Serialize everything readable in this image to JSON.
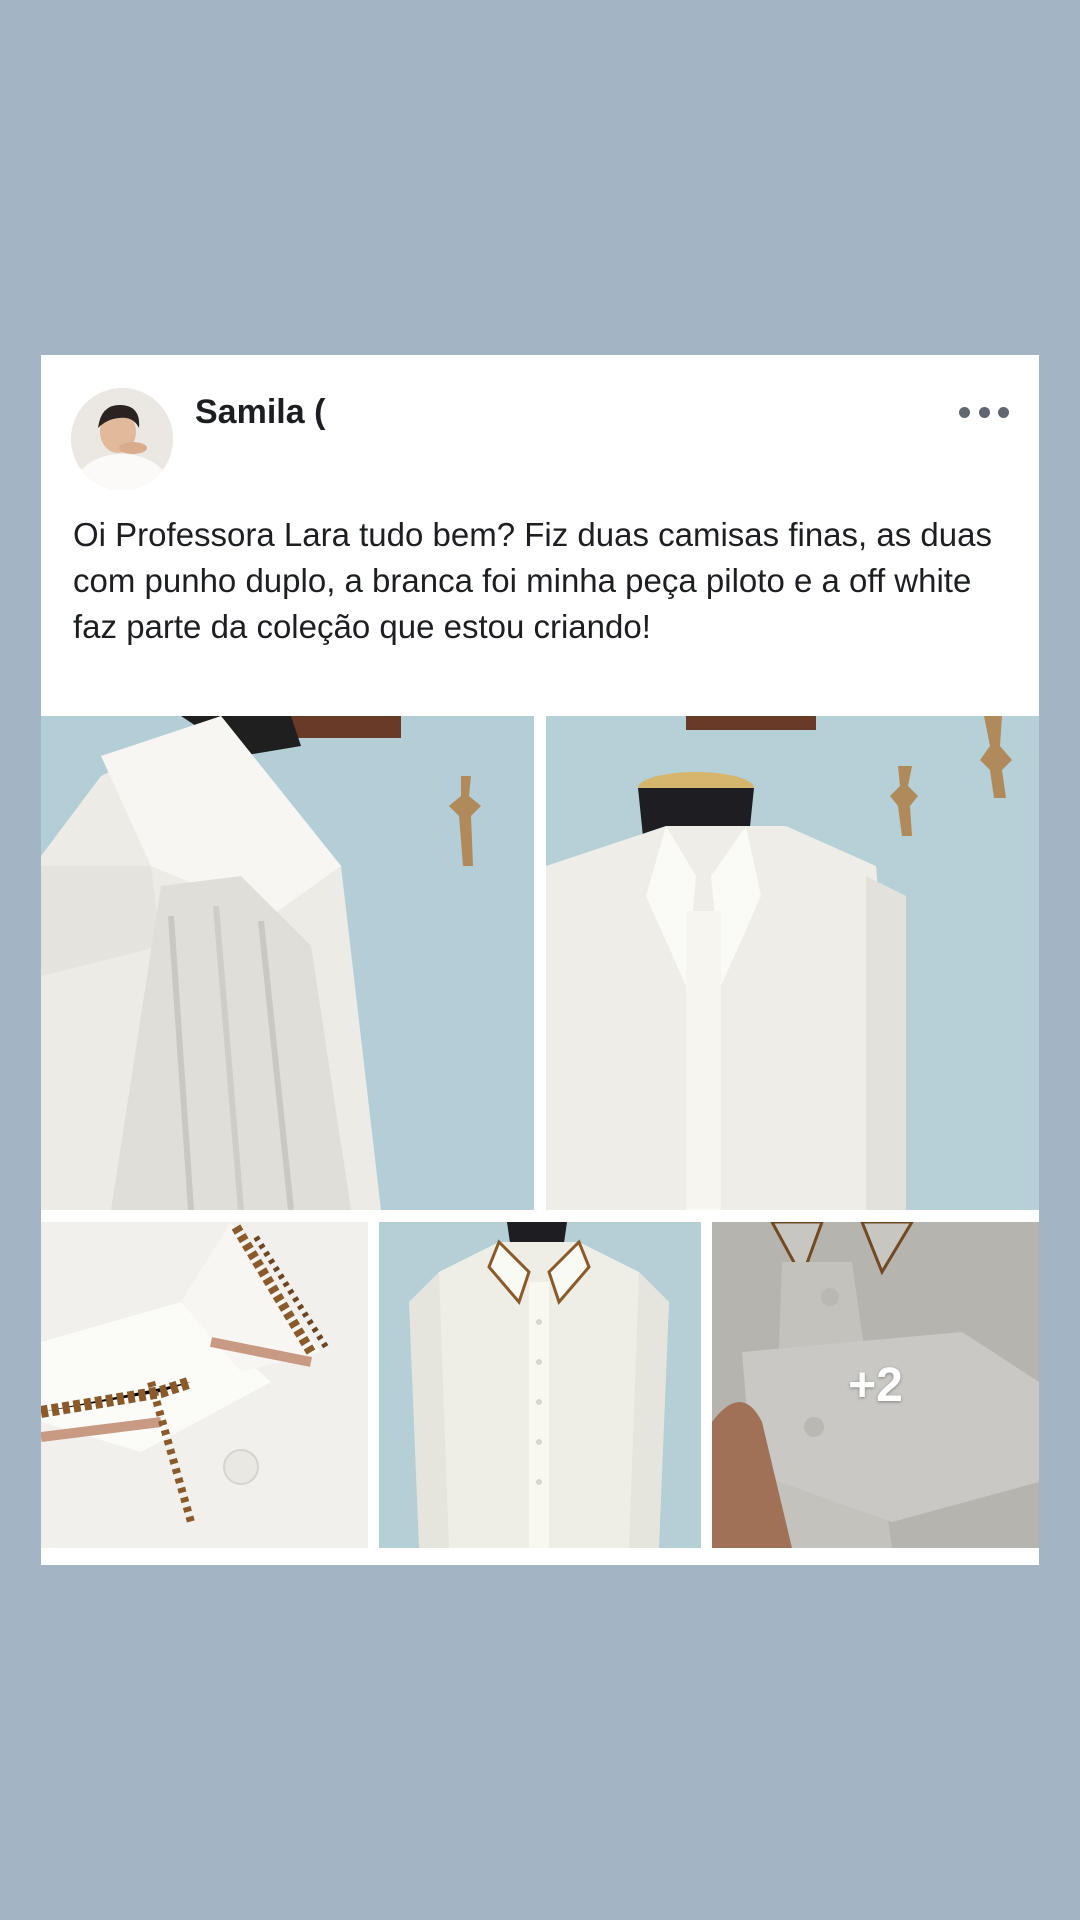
{
  "post": {
    "author": "Samila (",
    "text": "Oi Professora Lara tudo bem? Fiz duas camisas finas, as duas com punho duplo, a branca foi minha peça piloto e a off white faz parte da coleção que estou criando!",
    "more_photos_label": "+2"
  },
  "icons": {
    "more_options": "more-horizontal-icon"
  },
  "colors": {
    "page_background": "#a3b5c4",
    "card_background": "#ffffff",
    "text": "#1c1e21",
    "icon_gray": "#606770"
  }
}
